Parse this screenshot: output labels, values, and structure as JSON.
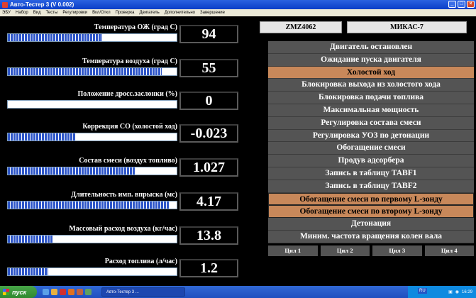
{
  "window": {
    "title": "Авто-Тестер 3  (V 0.002)"
  },
  "menu": [
    "ЭБУ",
    "Набор",
    "Вид",
    "Тесты",
    "Регулировки",
    "Вкл/Откл",
    "Проверка",
    "Двигатель",
    "Дополнительно",
    "Завершение"
  ],
  "parameters": [
    {
      "label": "Температура ОЖ (град С)",
      "value": "94",
      "level": 0.56
    },
    {
      "label": "Температура воздуха (град С)",
      "value": "55",
      "level": 0.91
    },
    {
      "label": "Положение дросс.заслонки (%)",
      "value": "0",
      "level": 0.0
    },
    {
      "label": "Коррекция CO (холостой ход)",
      "value": "-0.023",
      "level": 0.4
    },
    {
      "label": "Состав смеси (воздух топливо)",
      "value": "1.027",
      "level": 0.75
    },
    {
      "label": "Длительность имп. впрыска (мс)",
      "value": "4.17",
      "level": 0.96
    },
    {
      "label": "Массовый расход воздуха (кг/час)",
      "value": "13.8",
      "level": 0.27
    },
    {
      "label": "Расход топлива (л/час)",
      "value": "1.2",
      "level": 0.24
    }
  ],
  "engine_id": "ZMZ4062",
  "ecu_id": "МИКАС-7",
  "modes": [
    {
      "label": "Двигатель остановлен",
      "state": "off"
    },
    {
      "label": "Ожидание пуска двигателя",
      "state": "off"
    },
    {
      "label": "Холостой ход",
      "state": "on"
    },
    {
      "label": "Блокировка выхода из холостого хода",
      "state": "off"
    },
    {
      "label": "Блокировка подачи топлива",
      "state": "off"
    },
    {
      "label": "Максимальная мощность",
      "state": "off"
    },
    {
      "label": "Регулировка состава смеси",
      "state": "off"
    },
    {
      "label": "Регулировка УОЗ по детонации",
      "state": "off"
    },
    {
      "label": "Обогащение смеси",
      "state": "off"
    },
    {
      "label": "Продув адсорбера",
      "state": "off"
    },
    {
      "label": "Запись в таблицу TABF1",
      "state": "off"
    },
    {
      "label": "Запись в таблицу TABF2",
      "state": "off"
    },
    {
      "label": "Обогащение смеси по первому L-зонду",
      "state": "on-outline"
    },
    {
      "label": "Обогащение смеси по второму L-зонду",
      "state": "on-outline"
    },
    {
      "label": "Детонация",
      "state": "off"
    },
    {
      "label": "Миним. частота вращения колен вала",
      "state": "off"
    }
  ],
  "cylinders": [
    "Цил 1",
    "Цил 2",
    "Цил 3",
    "Цил 4"
  ],
  "taskbar": {
    "start_label": "пуск",
    "task_label": "Авто-Тестер 3 ...",
    "lang": "RU",
    "clock": "16:29"
  },
  "colors": {
    "active_mode": "#c8885a",
    "inactive_mode": "#545454",
    "bar_fill": "#2e56c8"
  }
}
